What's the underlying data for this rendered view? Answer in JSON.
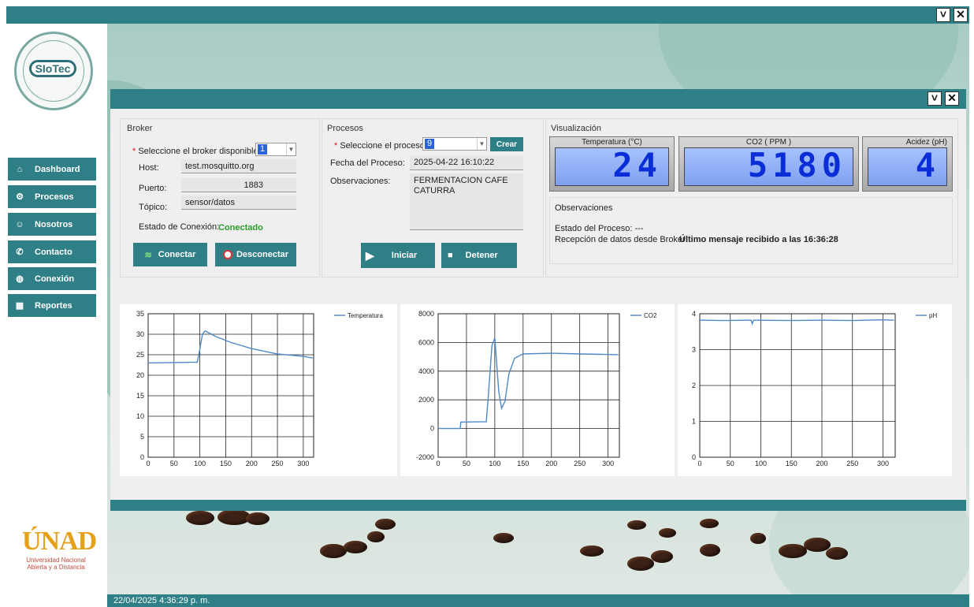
{
  "window": {
    "minimize_icon": "chevron-down-icon",
    "close_icon": "close-icon"
  },
  "logo": {
    "name": "SIoTec"
  },
  "nav": [
    {
      "label": "Dashboard",
      "icon": "home-icon",
      "glyph": "⌂"
    },
    {
      "label": "Procesos",
      "icon": "gear-icon",
      "glyph": "⚙"
    },
    {
      "label": "Nosotros",
      "icon": "users-icon",
      "glyph": "☺"
    },
    {
      "label": "Contacto",
      "icon": "phone-icon",
      "glyph": "✆"
    },
    {
      "label": "Conexión",
      "icon": "globe-icon",
      "glyph": "◍"
    },
    {
      "label": "Reportes",
      "icon": "calculator-icon",
      "glyph": "▦"
    }
  ],
  "unad": {
    "brand": "ÚNAD",
    "line1": "Universidad Nacional",
    "line2": "Abierta y a Distancia"
  },
  "status_bar": "22/04/2025 4:36:29 p. m.",
  "broker": {
    "title": "Broker",
    "select_label": "Seleccione el broker disponible:",
    "select_value": "1",
    "host_label": "Host:",
    "host_value": "test.mosquitto.org",
    "port_label": "Puerto:",
    "port_value": "1883",
    "topic_label": "Tópico:",
    "topic_value": "sensor/datos",
    "state_label": "Estado de Conexión:",
    "state_value": "Conectado",
    "connect_label": "Conectar",
    "disconnect_label": "Desconectar"
  },
  "procesos": {
    "title": "Procesos",
    "select_label": "Seleccione el proceso:",
    "select_value": "9",
    "create_label": "Crear",
    "date_label": "Fecha del Proceso:",
    "date_value": "2025-04-22 16:10:22",
    "obs_label": "Observaciones:",
    "obs_value": "FERMENTACION CAFE CATURRA",
    "start_label": "Iniciar",
    "stop_label": "Detener"
  },
  "visualizacion": {
    "title": "Visualización",
    "gauges": [
      {
        "title": "Temperatura (°C)",
        "value": "24"
      },
      {
        "title": "CO2 ( PPM )",
        "value": "5180"
      },
      {
        "title": "Acidez (pH)",
        "value": "4"
      }
    ],
    "obs_title": "Observaciones",
    "state_label": "Estado del Proceso:",
    "state_value": "---",
    "reception_label": "Recepción de datos desde Broker:",
    "reception_value": "Último mensaje recibido a las 16:36:28"
  },
  "chart_data": [
    {
      "type": "line",
      "series": [
        {
          "name": "Temperatura",
          "color": "#4f89c8",
          "x": [
            0,
            95,
            98,
            105,
            110,
            130,
            160,
            200,
            250,
            300,
            318
          ],
          "y": [
            23,
            23.2,
            25,
            30,
            30.8,
            29.5,
            28,
            26.5,
            25.2,
            24.6,
            24.2
          ]
        }
      ],
      "xlim": [
        0,
        320
      ],
      "ylim": [
        0,
        35
      ],
      "xticks": [
        0,
        50,
        100,
        150,
        200,
        250,
        300
      ],
      "yticks": [
        0,
        5,
        10,
        15,
        20,
        25,
        30,
        35
      ],
      "grid": true,
      "legend": "top-right"
    },
    {
      "type": "line",
      "series": [
        {
          "name": "CO2",
          "color": "#4f89c8",
          "x": [
            0,
            39,
            40,
            85,
            88,
            95,
            100,
            107,
            112,
            118,
            125,
            135,
            150,
            200,
            250,
            318
          ],
          "y": [
            0,
            0,
            450,
            480,
            2000,
            5800,
            6300,
            2600,
            1400,
            1900,
            3800,
            4900,
            5200,
            5250,
            5200,
            5150
          ]
        }
      ],
      "xlim": [
        0,
        320
      ],
      "ylim": [
        -2000,
        8000
      ],
      "xticks": [
        0,
        50,
        100,
        150,
        200,
        250,
        300
      ],
      "yticks": [
        -2000,
        0,
        2000,
        4000,
        6000,
        8000
      ],
      "grid": true,
      "legend": "top-right"
    },
    {
      "type": "line",
      "series": [
        {
          "name": "pH",
          "color": "#4f89c8",
          "x": [
            0,
            40,
            80,
            84,
            86,
            88,
            92,
            150,
            200,
            250,
            300,
            318
          ],
          "y": [
            3.82,
            3.81,
            3.82,
            3.82,
            3.72,
            3.82,
            3.82,
            3.81,
            3.82,
            3.81,
            3.83,
            3.82
          ]
        }
      ],
      "xlim": [
        0,
        320
      ],
      "ylim": [
        0,
        4
      ],
      "xticks": [
        0,
        50,
        100,
        150,
        200,
        250,
        300
      ],
      "yticks": [
        0,
        1,
        2,
        3,
        4
      ],
      "grid": true,
      "legend": "top-right"
    }
  ]
}
